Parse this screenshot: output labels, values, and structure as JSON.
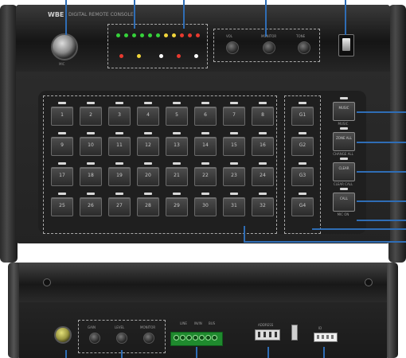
{
  "device": {
    "brand": "WBE",
    "model": "DIGITAL REMOTE CONSOLE",
    "mic_label": "MIC"
  },
  "top_knobs": [
    "VOL",
    "MONITOR",
    "TONE"
  ],
  "channel_keys": [
    [
      "1",
      "2",
      "3",
      "4",
      "5",
      "6",
      "7",
      "8"
    ],
    [
      "9",
      "10",
      "11",
      "12",
      "13",
      "14",
      "15",
      "16"
    ],
    [
      "17",
      "18",
      "19",
      "20",
      "21",
      "22",
      "23",
      "24"
    ],
    [
      "25",
      "26",
      "27",
      "28",
      "29",
      "30",
      "31",
      "32"
    ]
  ],
  "group_keys": [
    "G1",
    "G2",
    "G3",
    "G4"
  ],
  "func_keys": [
    {
      "label": "MUSIC",
      "caption": "MUSIC"
    },
    {
      "label": "ZONE ALL",
      "caption": "CHANGE ALL"
    },
    {
      "label": "CLEAR",
      "caption": "CLEAR CALL"
    },
    {
      "label": "CALL",
      "caption": "MIC ON"
    }
  ],
  "rear": {
    "terminal_labels": [
      "LINE",
      "IN/IN",
      "BUS"
    ],
    "knob_labels": [
      "GAIN",
      "LEVEL",
      "MONITOR"
    ],
    "dip_label": "ADDRESS",
    "link_label": "ID"
  },
  "colors": {
    "callout": "#2f6db5",
    "led_green": "#35d23a",
    "led_yellow": "#f1d53b",
    "led_red": "#e83a2f",
    "terminal": "#1f8a2e"
  }
}
